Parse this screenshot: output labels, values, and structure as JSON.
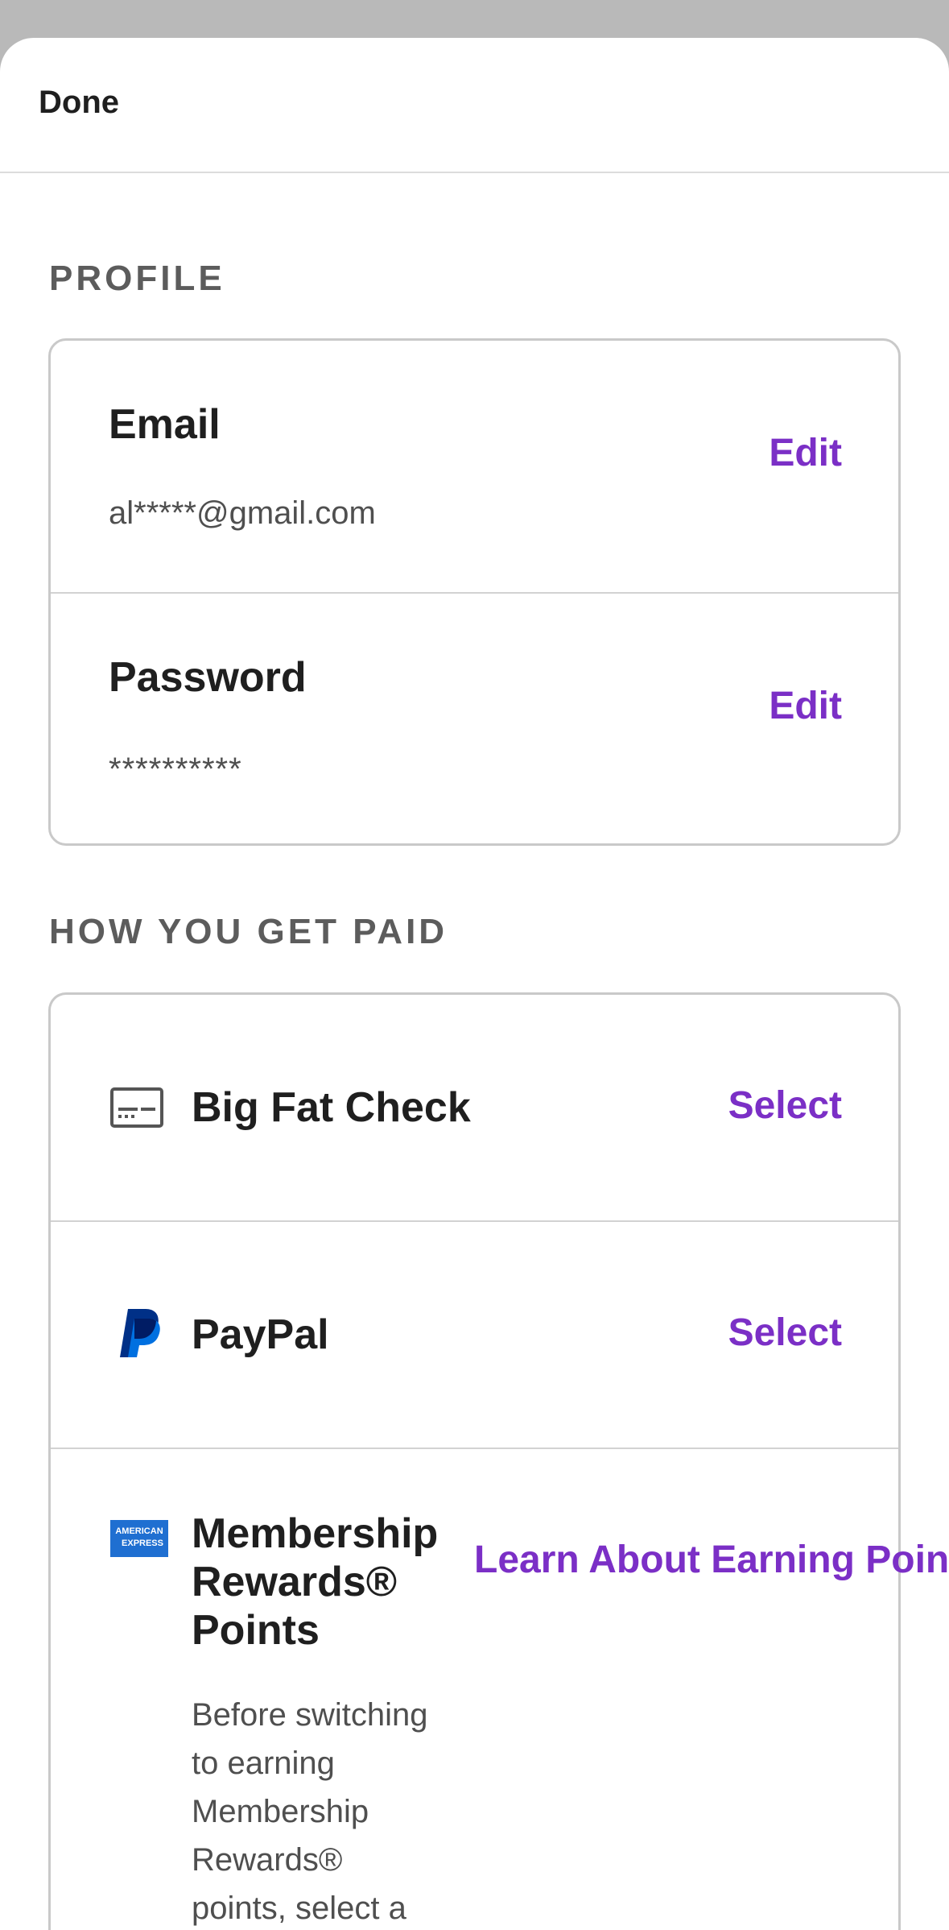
{
  "topbar": {
    "done_label": "Done"
  },
  "profile": {
    "section_title": "PROFILE",
    "email": {
      "label": "Email",
      "value": "al*****@gmail.com",
      "action": "Edit"
    },
    "password": {
      "label": "Password",
      "value": "**********",
      "action": "Edit"
    }
  },
  "payment": {
    "section_title": "HOW YOU GET PAID",
    "options": [
      {
        "label": "Big Fat Check",
        "action": "Select",
        "icon": "check-icon"
      },
      {
        "label": "PayPal",
        "action": "Select",
        "icon": "paypal-icon"
      },
      {
        "label_lines": [
          "Membership",
          "Rewards®",
          "Points"
        ],
        "action": "Learn About Earning Points",
        "icon": "american-express-icon",
        "icon_text": [
          "AMERICAN",
          "EXPRESS"
        ],
        "description_lines": [
          "Before switching",
          "to earning",
          "Membership",
          "Rewards®",
          "points, select a"
        ]
      }
    ]
  },
  "colors": {
    "accent": "#7b2fc6",
    "paypal_dark": "#003087",
    "paypal_light": "#0070e0",
    "amex_blue": "#1f6fd1"
  }
}
